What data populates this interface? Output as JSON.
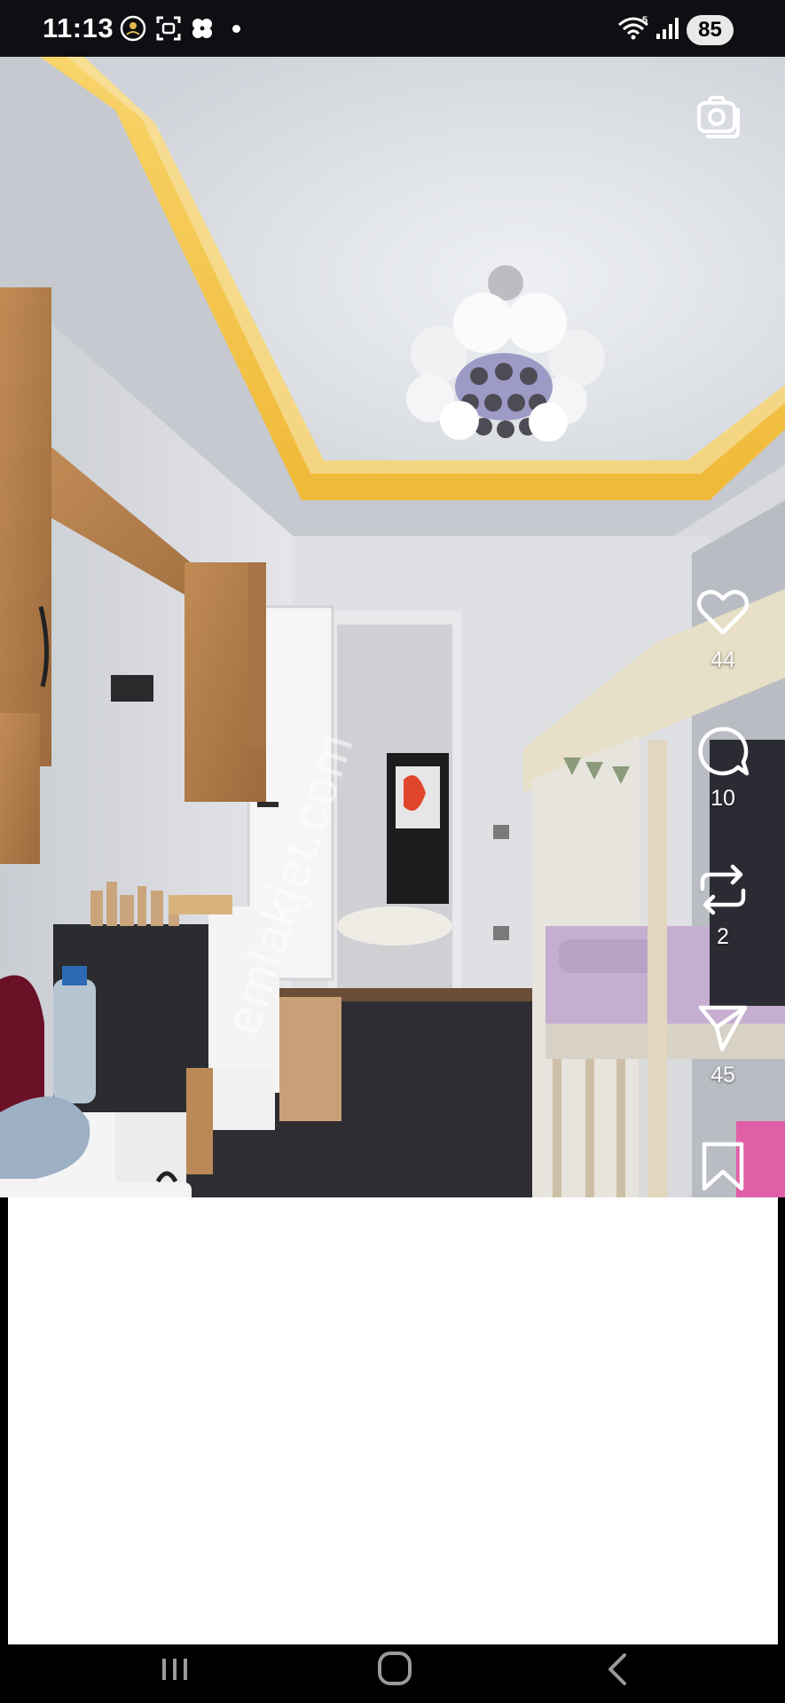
{
  "status_bar": {
    "time": "11:13",
    "battery": "85",
    "icons": [
      "notification-app-icon",
      "screenshot-icon",
      "clover-icon",
      "notification-dot",
      "wifi-icon",
      "signal-icon",
      "battery-icon"
    ],
    "wifi_label": "5"
  },
  "post": {
    "watermark": "emlakjet.com",
    "media_icon": "camera-icon"
  },
  "actions": {
    "like": {
      "icon": "heart-icon",
      "count": "44"
    },
    "comment": {
      "icon": "comment-icon",
      "count": "10"
    },
    "repost": {
      "icon": "repost-icon",
      "count": "2"
    },
    "share": {
      "icon": "send-icon",
      "count": "45"
    },
    "save": {
      "icon": "bookmark-icon"
    }
  },
  "navigation": {
    "buttons": [
      "recents-icon",
      "home-icon",
      "back-icon"
    ]
  },
  "colors": {
    "status_bar_bg": "#0d0f12",
    "ceiling_glow": "#f5c343",
    "wood": "#b07c48",
    "panel": "#ffffff"
  }
}
